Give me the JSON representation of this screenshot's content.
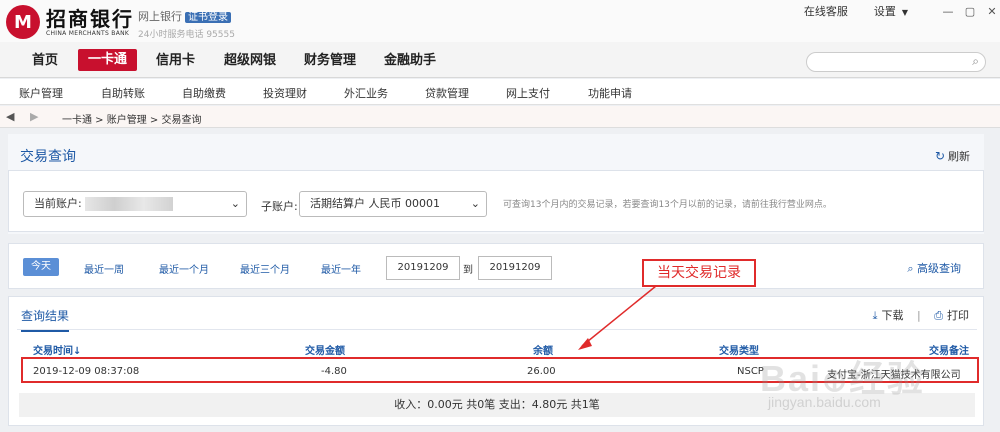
{
  "header": {
    "logo_cn": "招商银行",
    "logo_en": "CHINA MERCHANTS BANK",
    "site_label": "网上银行",
    "cert_badge": "证书登录",
    "hotline": "24小时服务电话 95555",
    "online_service": "在线客服",
    "settings": "设置"
  },
  "mainnav": {
    "tabs": [
      "首页",
      "一卡通",
      "信用卡",
      "超级网银",
      "财务管理",
      "金融助手"
    ],
    "active_tab": "一卡通",
    "search_placeholder": ""
  },
  "subnav": {
    "items": [
      "账户管理",
      "自助转账",
      "自助缴费",
      "投资理财",
      "外汇业务",
      "贷款管理",
      "网上支付",
      "功能申请"
    ]
  },
  "breadcrumb": {
    "text": "一卡通 > 账户管理 > 交易查询"
  },
  "page": {
    "title": "交易查询",
    "refresh": "刷新"
  },
  "account": {
    "current_label": "当前账户:",
    "sub_label": "子账户:",
    "sub_value": "活期结算户 人民币 00001",
    "note": "可查询13个月内的交易记录，若要查询13个月以前的记录，请前往我行营业网点。"
  },
  "date_filter": {
    "today": "今天",
    "ranges": [
      "最近一周",
      "最近一个月",
      "最近三个月",
      "最近一年"
    ],
    "from": "20191209",
    "to_label": "到",
    "to": "20191209",
    "advanced": "高级查询"
  },
  "annotation": {
    "label": "当天交易记录",
    "color": "#e02b2b"
  },
  "results": {
    "title": "查询结果",
    "download": "下载",
    "print": "打印",
    "columns": [
      "交易时间↓",
      "交易金额",
      "余额",
      "交易类型",
      "交易备注"
    ],
    "rows": [
      {
        "time": "2019-12-09  08:37:08",
        "amount": "-4.80",
        "balance": "26.00",
        "type": "NSCP",
        "remark": "支付宝-浙江天猫技术有限公司"
      }
    ],
    "summary": "收入：0.00元  共0笔     支出：4.80元  共1笔"
  },
  "watermark": {
    "main": "Baidu 经验",
    "sub": "jingyan.baidu.com"
  },
  "colors": {
    "brand_red": "#c8102e",
    "link_blue": "#1f5aa6",
    "button_blue": "#5b8fd6"
  }
}
